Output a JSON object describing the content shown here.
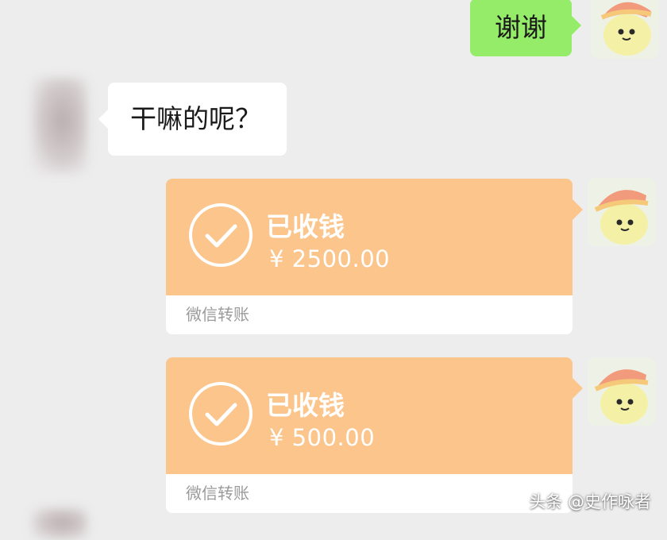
{
  "colors": {
    "background": "#ededed",
    "sent_bubble": "#95ec69",
    "received_bubble": "#ffffff",
    "transfer_card": "#fbc58c",
    "transfer_footer_text": "#9a9a9a"
  },
  "messages": [
    {
      "sender": "me",
      "type": "text",
      "text": "谢谢"
    },
    {
      "sender": "other",
      "type": "text",
      "text": "干嘛的呢？"
    },
    {
      "sender": "me",
      "type": "transfer",
      "status": "已收钱",
      "amount": "¥ 2500.00",
      "footer": "微信转账",
      "icon": "check-circle-icon"
    },
    {
      "sender": "me",
      "type": "transfer",
      "status": "已收钱",
      "amount": "¥ 500.00",
      "footer": "微信转账",
      "icon": "check-circle-icon"
    }
  ],
  "watermark": "头条 @史作咏者"
}
